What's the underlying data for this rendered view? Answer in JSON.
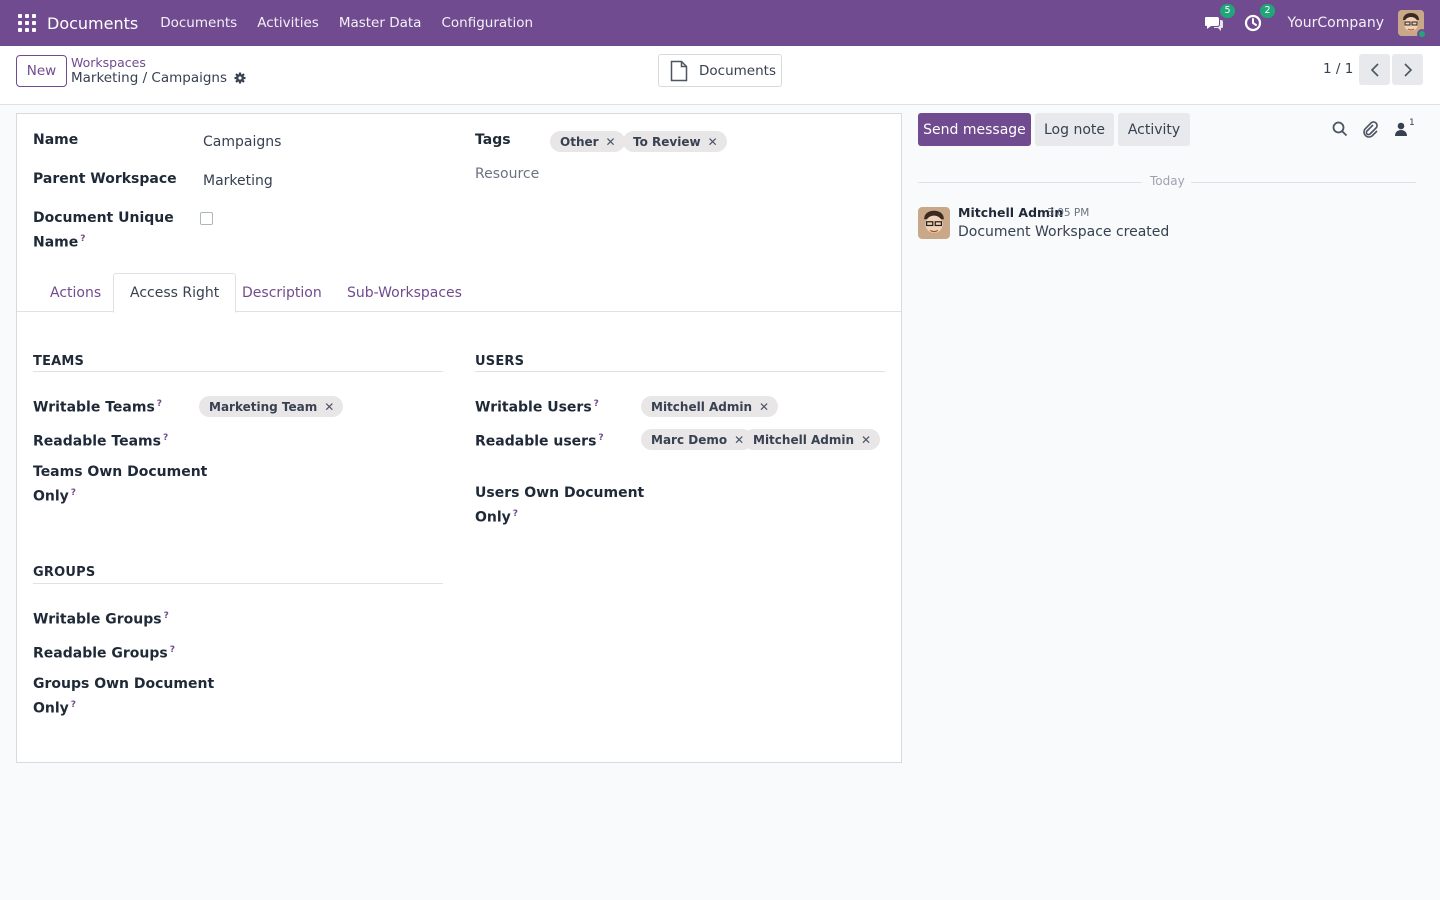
{
  "navbar": {
    "brand": "Documents",
    "menu": [
      "Documents",
      "Activities",
      "Master Data",
      "Configuration"
    ],
    "messages_badge": "5",
    "activities_badge": "2",
    "company": "YourCompany",
    "bg_color": "#714b8f"
  },
  "control": {
    "new_label": "New",
    "breadcrumb_parent": "Workspaces",
    "breadcrumb_current": "Marketing / Campaigns",
    "smart_button_label": "Documents",
    "pager": "1 / 1"
  },
  "form": {
    "name_label": "Name",
    "name_value": "Campaigns",
    "parent_label": "Parent Workspace",
    "parent_value": "Marketing",
    "unique_label_1": "Document Unique",
    "unique_label_2": "Name",
    "tags_label": "Tags",
    "tags": [
      "Other",
      "To Review"
    ],
    "resource_label": "Resource"
  },
  "tabs": [
    "Actions",
    "Access Right",
    "Description",
    "Sub-Workspaces"
  ],
  "access": {
    "teams_title": "TEAMS",
    "writable_teams_label": "Writable Teams",
    "writable_teams": [
      "Marketing Team"
    ],
    "readable_teams_label": "Readable Teams",
    "teams_own_1": "Teams Own Document",
    "teams_own_2": "Only",
    "groups_title": "GROUPS",
    "writable_groups_label": "Writable Groups",
    "readable_groups_label": "Readable Groups",
    "groups_own_1": "Groups Own Document",
    "groups_own_2": "Only",
    "users_title": "USERS",
    "writable_users_label": "Writable Users",
    "writable_users": [
      "Mitchell Admin"
    ],
    "readable_users_label": "Readable users",
    "readable_users": [
      "Marc Demo",
      "Mitchell Admin"
    ],
    "users_own_1": "Users Own Document",
    "users_own_2": "Only",
    "help_mark": "?"
  },
  "chatter": {
    "send_message": "Send message",
    "log_note": "Log note",
    "activity": "Activity",
    "followers_count": "1",
    "today": "Today",
    "message": {
      "author": "Mitchell Admin",
      "time": "3:05 PM",
      "body": "Document Workspace created"
    }
  }
}
